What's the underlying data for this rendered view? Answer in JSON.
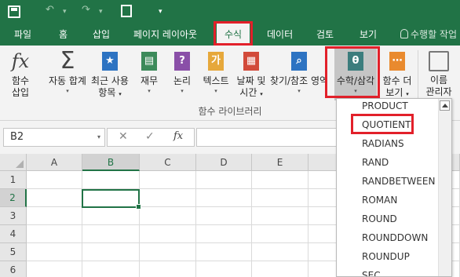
{
  "qat": {
    "save_icon": "save-icon",
    "undo_icon": "undo-icon",
    "redo_icon": "redo-icon",
    "preview_icon": "print-preview-icon",
    "undo_glyph": "↶",
    "redo_glyph": "↷",
    "dropdown_glyph": "▾",
    "more_glyph": "▾"
  },
  "tabs": [
    {
      "label": "파일"
    },
    {
      "label": "홈"
    },
    {
      "label": "삽입"
    },
    {
      "label": "페이지 레이아웃"
    },
    {
      "label": "수식"
    },
    {
      "label": "데이터"
    },
    {
      "label": "검토"
    },
    {
      "label": "보기"
    }
  ],
  "active_tab_index": 4,
  "tell_me": {
    "placeholder": "수행할 작업"
  },
  "ribbon": {
    "buttons": [
      {
        "label1": "함수",
        "label2": "삽입",
        "icon": "fx",
        "has_dropdown": false
      },
      {
        "label1": "자동 합계",
        "label2": "",
        "icon": "sigma-icon",
        "has_dropdown": true
      },
      {
        "label1": "최근 사용",
        "label2": "항목",
        "icon": "star-book-icon",
        "has_dropdown": true
      },
      {
        "label1": "재무",
        "label2": "",
        "icon": "finance-book-icon",
        "has_dropdown": true
      },
      {
        "label1": "논리",
        "label2": "",
        "icon": "question-book-icon",
        "has_dropdown": true
      },
      {
        "label1": "텍스트",
        "label2": "",
        "icon": "text-book-icon",
        "has_dropdown": true
      },
      {
        "label1": "날짜 및",
        "label2": "시간",
        "icon": "calendar-book-icon",
        "has_dropdown": true
      },
      {
        "label1": "찾기/참조 영역",
        "label2": "",
        "icon": "search-book-icon",
        "has_dropdown": true
      },
      {
        "label1": "수학/삼각",
        "label2": "",
        "icon": "theta-book-icon",
        "has_dropdown": true
      },
      {
        "label1": "함수 더",
        "label2": "보기",
        "icon": "more-functions-icon",
        "has_dropdown": true
      },
      {
        "label1": "이름",
        "label2": "관리자",
        "icon": "name-manager-icon",
        "has_dropdown": false
      }
    ],
    "icon_glyphs": {
      "fx": "fx",
      "sigma": "Σ",
      "star": "★",
      "finance": "▤",
      "question": "?",
      "text": "가",
      "calendar": "▦",
      "search": "⌕",
      "theta": "θ",
      "more": "⋯"
    },
    "group_label": "함수 라이브러리",
    "dropdown_glyph": "▾"
  },
  "formula_bar": {
    "name_box": "B2",
    "cancel_glyph": "✕",
    "enter_glyph": "✓",
    "fx_label": "fx",
    "name_box_dd": "▾",
    "formula_value": ""
  },
  "grid": {
    "columns": [
      "A",
      "B",
      "C",
      "D",
      "E"
    ],
    "rows": [
      "1",
      "2",
      "3",
      "4",
      "5",
      "6"
    ],
    "active_cell": "B2"
  },
  "dropdown": {
    "items": [
      "PRODUCT",
      "QUOTIENT",
      "RADIANS",
      "RAND",
      "RANDBETWEEN",
      "ROMAN",
      "ROUND",
      "ROUNDDOWN",
      "ROUNDUP",
      "SEC"
    ],
    "highlighted_item": "QUOTIENT"
  },
  "colors": {
    "brand_green": "#217346",
    "highlight_red": "#e2202a",
    "book_blue": "#2d73c2",
    "book_green": "#3c8a5a",
    "book_purple": "#8a4fa8",
    "book_yellow": "#e6a83b",
    "book_red": "#d24a3a",
    "book_teal": "#3c7d7d",
    "book_orange": "#e98a2e"
  }
}
